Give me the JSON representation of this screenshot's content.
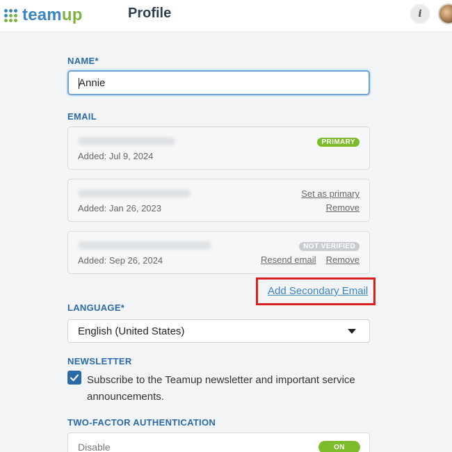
{
  "header": {
    "logo_text": "team",
    "logo_text_accent": "up",
    "page_title": "Profile",
    "info_icon": "i"
  },
  "colors": {
    "brand_blue": "#3a84c8",
    "brand_green": "#7cb342",
    "highlight_red": "#d9201f",
    "label_blue": "#2a6aa8"
  },
  "name": {
    "label": "NAME*",
    "value": "Annie"
  },
  "email": {
    "label": "EMAIL",
    "entries": [
      {
        "added": "Added: Jul 9, 2024",
        "badge": "PRIMARY"
      },
      {
        "added": "Added: Jan 26, 2023",
        "action1": "Set as primary",
        "action2": "Remove"
      },
      {
        "added": "Added: Sep 26, 2024",
        "badge": "NOT VERIFIED",
        "action1": "Resend email",
        "action2": "Remove"
      }
    ],
    "add_secondary": "Add Secondary Email"
  },
  "language": {
    "label": "LANGUAGE*",
    "selected": "English (United States)"
  },
  "newsletter": {
    "label": "NEWSLETTER",
    "checked": true,
    "text": "Subscribe to the Teamup newsletter and important service announcements."
  },
  "two_factor": {
    "label": "TWO-FACTOR AUTHENTICATION",
    "state_label": "Disable",
    "toggle": "ON"
  }
}
